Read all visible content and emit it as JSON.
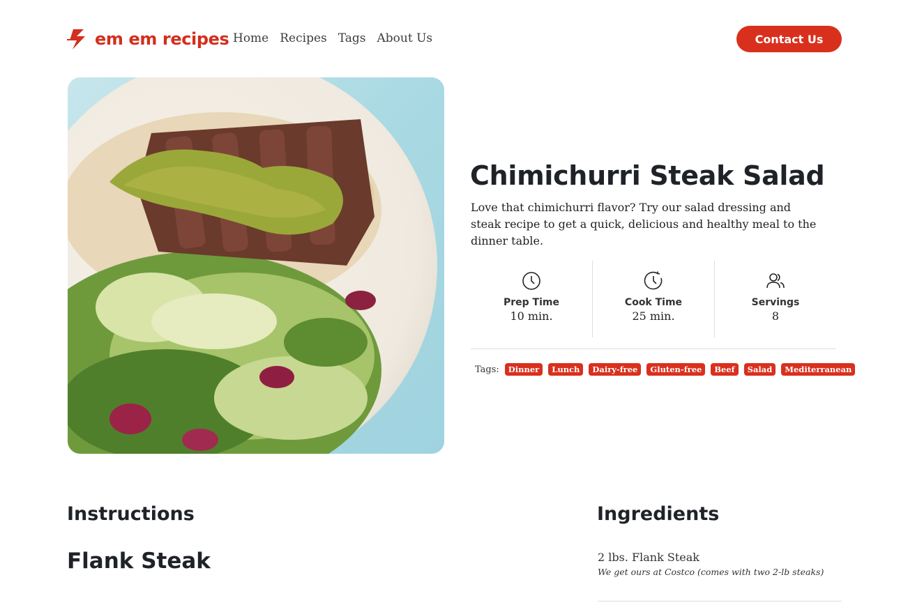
{
  "brand": {
    "name": "em em recipes",
    "color": "#d42e1c"
  },
  "nav": [
    "Home",
    "Recipes",
    "Tags",
    "About Us"
  ],
  "contact_button": "Contact Us",
  "hero_image": {
    "alt": "Chimichurri Steak Salad",
    "icon": "photo"
  },
  "recipe": {
    "title": "Chimichurri Steak Salad",
    "description": "Love that chimichurri flavor? Try our salad dressing and steak recipe to get a quick, delicious and healthy meal to the dinner table.",
    "stats": [
      {
        "icon": "clock-icon",
        "label": "Prep Time",
        "value": "10 min."
      },
      {
        "icon": "timer-icon",
        "label": "Cook Time",
        "value": "25 min."
      },
      {
        "icon": "users-icon",
        "label": "Servings",
        "value": "8"
      }
    ],
    "tags_label": "Tags:",
    "tags": [
      "Dinner",
      "Lunch",
      "Dairy-free",
      "Gluten-free",
      "Beef",
      "Salad",
      "Mediterranean"
    ]
  },
  "instructions": {
    "heading": "Instructions",
    "section_title": "Flank Steak"
  },
  "ingredients": {
    "heading": "Ingredients",
    "items": [
      {
        "name": "2 lbs. Flank Steak",
        "note": "We get ours at Costco (comes with two 2-lb steaks)"
      }
    ]
  },
  "accent_color": "#d9301e"
}
